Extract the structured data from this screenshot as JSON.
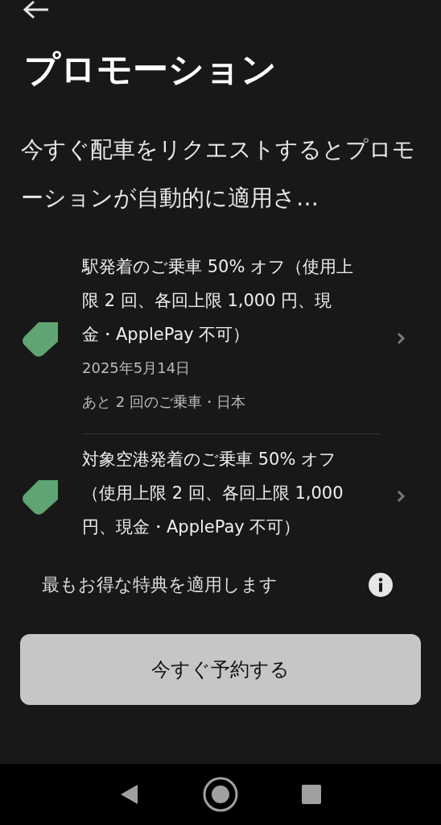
{
  "header": {
    "title": "プロモーション"
  },
  "description": "今すぐ配車をリクエストするとプロモーションが自動的に適用さ…",
  "promotions": [
    {
      "title": "駅発着のご乗車 50% オフ（使用上限 2 回、各回上限 1,000 円、現金・ApplePay 不可）",
      "date": "2025年5月14日",
      "detail": "あと 2 回のご乗車・日本"
    },
    {
      "title": "対象空港発着のご乗車 50% オフ（使用上限 2 回、各回上限 1,000 円、現金・ApplePay 不可）"
    }
  ],
  "note": "最もお得な特典を適用します",
  "primary_button": "今すぐ予約する"
}
